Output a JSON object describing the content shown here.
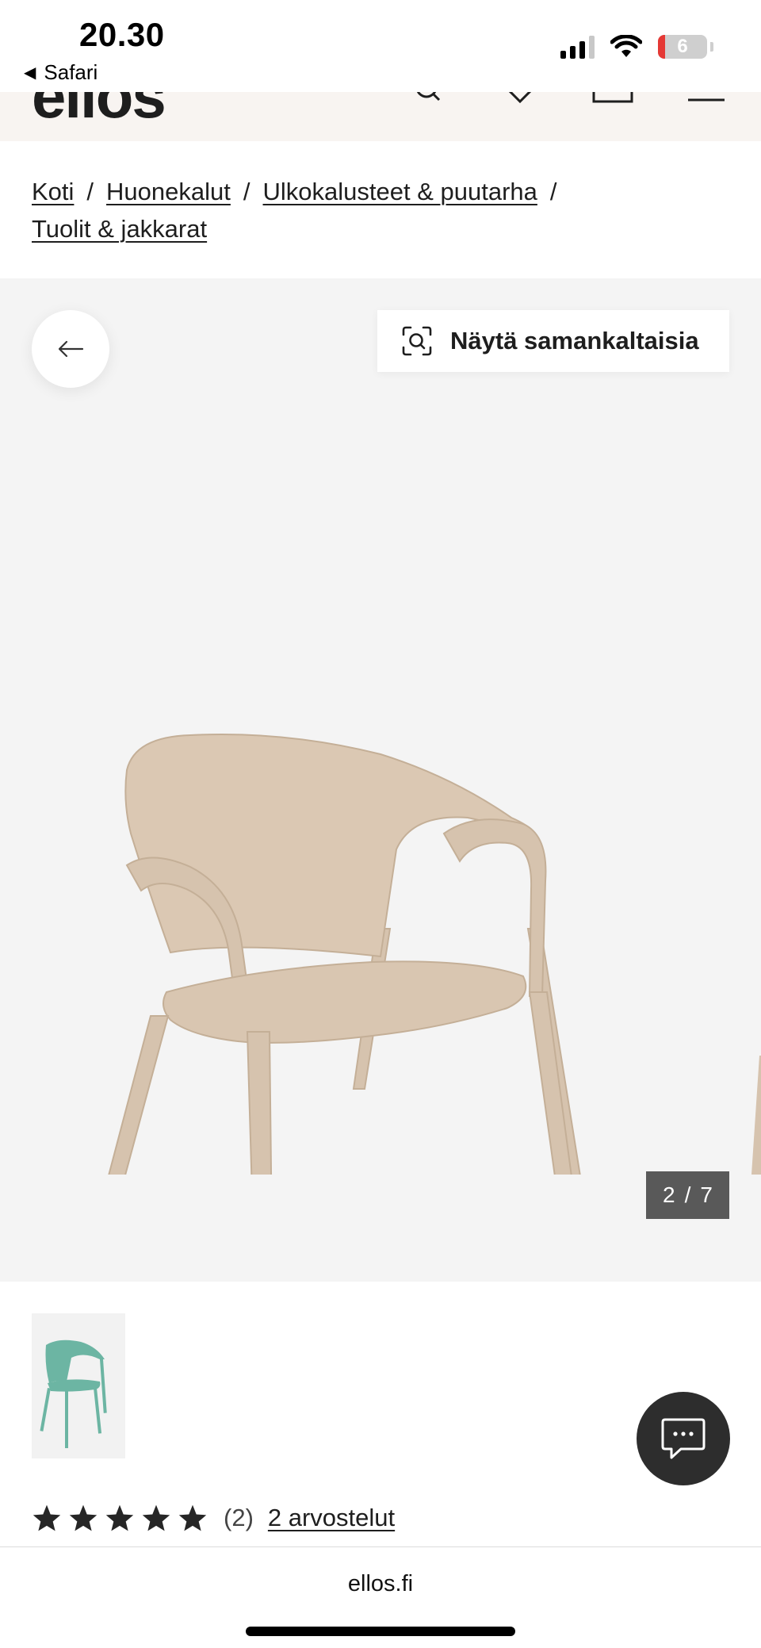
{
  "status_bar": {
    "time": "20.30",
    "back_app": "Safari",
    "battery_level": "6"
  },
  "header": {
    "logo": "ellos"
  },
  "breadcrumb": {
    "items": [
      "Koti",
      "Huonekalut",
      "Ulkokalusteet & puutarha",
      "Tuolit & jakkarat"
    ],
    "separator": "/"
  },
  "gallery": {
    "similar_label": "Näytä samankaltaisia",
    "current_index": "2",
    "separator": "/",
    "total": "7",
    "main_color": "#d6c3ae",
    "thumb_color": "#6cb5a3"
  },
  "rating": {
    "stars": 5,
    "count": "(2)",
    "reviews_link": "2 arvostelut"
  },
  "browser": {
    "url": "ellos.fi"
  }
}
